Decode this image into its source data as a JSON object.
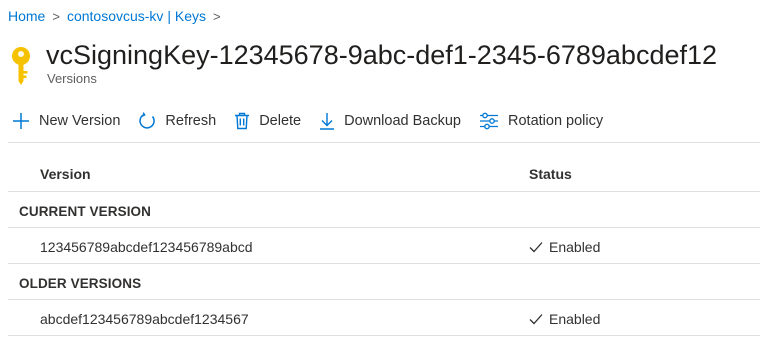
{
  "breadcrumb": {
    "items": [
      "Home",
      "contosovcus-kv | Keys"
    ],
    "separator": ">"
  },
  "header": {
    "title": "vcSigningKey-12345678-9abc-def1-2345-6789abcdef12",
    "subtitle": "Versions",
    "icon": "key-icon"
  },
  "toolbar": {
    "new_version": "New Version",
    "refresh": "Refresh",
    "delete": "Delete",
    "download_backup": "Download Backup",
    "rotation_policy": "Rotation policy"
  },
  "table": {
    "columns": [
      "Version",
      "Status"
    ],
    "groups": [
      {
        "label": "CURRENT VERSION",
        "rows": [
          {
            "version": "123456789abcdef123456789abcd",
            "status": "Enabled"
          }
        ]
      },
      {
        "label": "OLDER VERSIONS",
        "rows": [
          {
            "version": "abcdef123456789abcdef1234567",
            "status": "Enabled"
          }
        ]
      }
    ]
  },
  "colors": {
    "link": "#0078d4",
    "key_gold": "#f6c200",
    "toolbar_icon": "#0078d4",
    "border": "#e1dfdd"
  }
}
